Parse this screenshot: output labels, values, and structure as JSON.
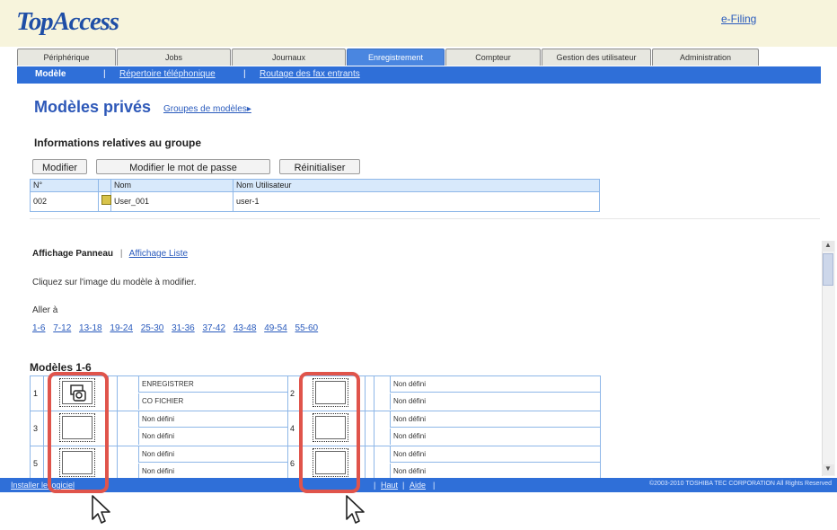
{
  "header": {
    "logo": "TopAccess",
    "efiling_link": "e-Filing"
  },
  "tabs": [
    {
      "label": "Périphérique",
      "active": false
    },
    {
      "label": "Jobs",
      "active": false
    },
    {
      "label": "Journaux",
      "active": false
    },
    {
      "label": "Enregistrement",
      "active": true
    },
    {
      "label": "Compteur",
      "active": false
    },
    {
      "label": "Gestion des utilisateur",
      "active": false
    },
    {
      "label": "Administration",
      "active": false
    }
  ],
  "subnav": {
    "active": "Modèle",
    "sep": "|",
    "link1": "Répertoire téléphonique",
    "link2": "Routage des fax entrants"
  },
  "page": {
    "title": "Modèles privés",
    "groups_link": "Groupes de modèles▸"
  },
  "group_info": {
    "title": "Informations relatives au groupe",
    "buttons": {
      "modify": "Modifier",
      "change_password": "Modifier le mot de passe",
      "reset": "Réinitialiser"
    },
    "headers": {
      "no": "N°",
      "name": "Nom",
      "user_name": "Nom Utilisateur"
    },
    "row": {
      "no": "002",
      "name": "User_001",
      "user_name": "user-1"
    }
  },
  "view": {
    "panel": "Affichage Panneau",
    "sep": "|",
    "list": "Affichage Liste"
  },
  "instruction": "Cliquez sur l'image du modèle à modifier.",
  "goto_label": "Aller à",
  "ranges": [
    "1-6",
    "7-12",
    "13-18",
    "19-24",
    "25-30",
    "31-36",
    "37-42",
    "43-48",
    "49-54",
    "55-60"
  ],
  "templates": {
    "title": "Modèles 1-6",
    "items": [
      {
        "num": "1",
        "line1": "ENREGISTRER",
        "line2": "CO FICHIER",
        "icon": "save-to-file-icon"
      },
      {
        "num": "2",
        "line1": "Non défini",
        "line2": "Non défini",
        "icon": ""
      },
      {
        "num": "3",
        "line1": "Non défini",
        "line2": "Non défini",
        "icon": ""
      },
      {
        "num": "4",
        "line1": "Non défini",
        "line2": "Non défini",
        "icon": ""
      },
      {
        "num": "5",
        "line1": "Non défini",
        "line2": "Non défini",
        "icon": ""
      },
      {
        "num": "6",
        "line1": "Non défini",
        "line2": "Non défini",
        "icon": ""
      }
    ]
  },
  "footer": {
    "install": "Installer le logiciel",
    "sep": "|",
    "top": "Haut",
    "help": "Aide",
    "copyright": "©2003-2010 TOSHIBA TEC CORPORATION All Rights Reserved"
  },
  "colors": {
    "brand_blue": "#2f6fd8",
    "active_tab": "#4a86e0",
    "highlight": "#e0544b",
    "header_bg": "#f7f4dc"
  }
}
